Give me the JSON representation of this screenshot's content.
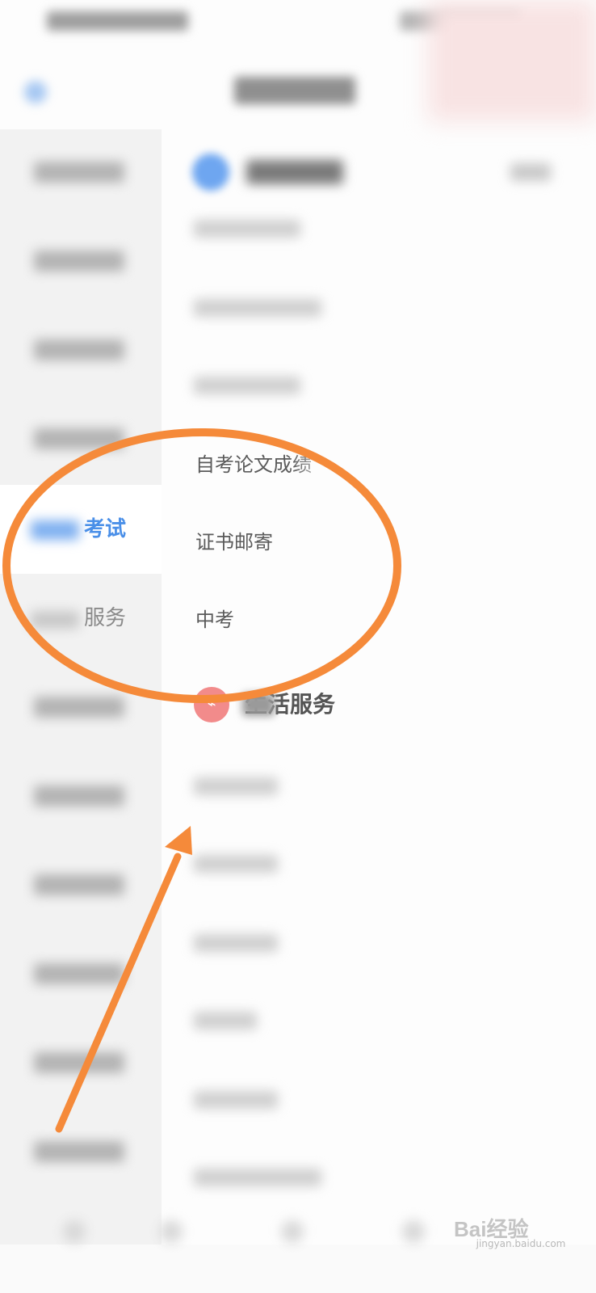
{
  "sidebar": {
    "active_label": "考试",
    "next_label": "服务"
  },
  "list": {
    "item_thesis": "自考论文成绩",
    "item_cert": "证书邮寄",
    "item_zhongkao": "中考"
  },
  "section": {
    "life_title": "生活服务",
    "life_icon_glyph": "⌁"
  },
  "colors": {
    "accent_blue": "#4a8fe8",
    "annotation_orange": "#f58a3a",
    "life_icon_red": "#f28b8b"
  },
  "watermark": {
    "brand": "Bai经验",
    "url": "jingyan.baidu.com"
  }
}
